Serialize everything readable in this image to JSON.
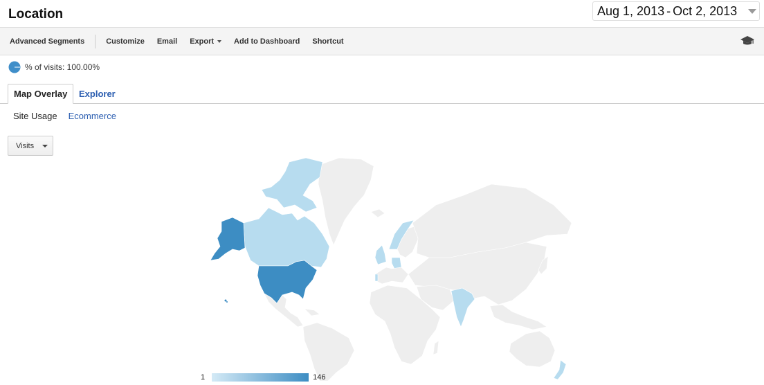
{
  "header": {
    "title": "Location",
    "date_start": "Aug 1, 2013",
    "date_sep": "-",
    "date_end": "Oct 2, 2013"
  },
  "toolbar": {
    "advanced_segments": "Advanced Segments",
    "customize": "Customize",
    "email": "Email",
    "export": "Export",
    "add_to_dashboard": "Add to Dashboard",
    "shortcut": "Shortcut",
    "cap_icon": "graduation-cap-icon"
  },
  "summary": {
    "label": "% of visits: 100.00%",
    "pie_fraction": 1.0
  },
  "tabs": {
    "map_overlay": "Map Overlay",
    "explorer": "Explorer"
  },
  "subtabs": {
    "site_usage": "Site Usage",
    "ecommerce": "Ecommerce"
  },
  "metric_select": {
    "value": "Visits"
  },
  "map": {
    "legend_min": "1",
    "legend_max": "146",
    "colors": {
      "low": "#d4eaf6",
      "high": "#3d8dc3",
      "no_data": "#eeeeee"
    }
  }
}
